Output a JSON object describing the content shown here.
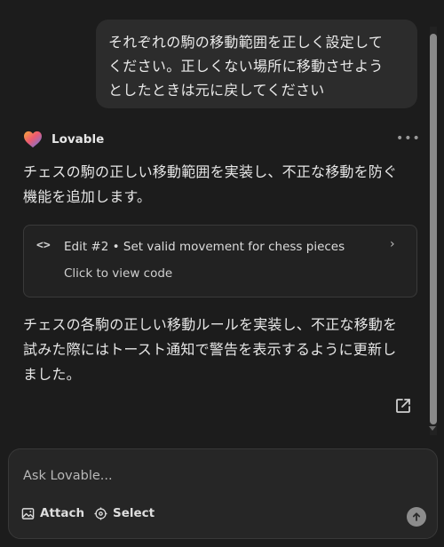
{
  "user_message": {
    "line1": "それぞれの駒の移動範囲を正しく設定して",
    "line2": "ください。正しくない場所に移動させよう",
    "line3": "としたときは元に戻してください"
  },
  "assistant": {
    "name": "Lovable",
    "more_icon": "more-horizontal-icon",
    "intro_line1": "チェスの駒の正しい移動範囲を実装し、不正な移動を防ぐ",
    "intro_line2": "機能を追加します。",
    "edit_card": {
      "code_glyph": "<>",
      "title": "Edit #2 • Set valid movement for chess pieces",
      "subtitle": "Click to view code",
      "chevron": "›"
    },
    "summary_line1": "チェスの各駒の正しい移動ルールを実装し、不正な移動を",
    "summary_line2": "試みた際にはトースト通知で警告を表示するように更新し",
    "summary_line3": "ました。"
  },
  "composer": {
    "placeholder": "Ask Lovable...",
    "attach_label": "Attach",
    "select_label": "Select",
    "send_icon": "arrow-up-icon"
  },
  "colors": {
    "background": "#1c1c1c",
    "bubble": "#2c2c2c",
    "card": "#222222",
    "send": "#8c8c8c"
  }
}
